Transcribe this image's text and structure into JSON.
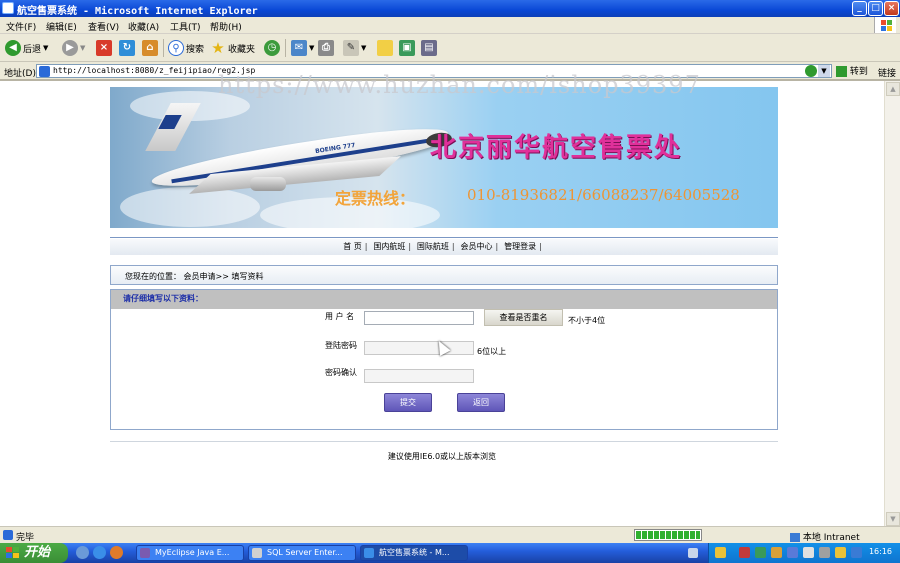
{
  "window": {
    "title": "航空售票系统 - Microsoft Internet Explorer",
    "minimize": "_",
    "maximize": "□",
    "close": "×"
  },
  "menu": [
    "文件(F)",
    "编辑(E)",
    "查看(V)",
    "收藏(A)",
    "工具(T)",
    "帮助(H)"
  ],
  "toolbar": {
    "back_label": "后退",
    "search_label": "搜索",
    "favorites_label": "收藏夹"
  },
  "address": {
    "label": "地址(D)",
    "url": "http://localhost:8080/z_feijipiao/reg2.jsp",
    "go_label": "转到",
    "links_label": "链接"
  },
  "watermark": "https://www.huzhan.com/ishop39397",
  "banner": {
    "brand": "BOEING 777",
    "title": "北京丽华航空售票处",
    "hotline_label": "定票热线：",
    "hotline_number": "010-81936821/66088237/64005528"
  },
  "nav": {
    "items": [
      "首 页",
      "国内航班",
      "国际航班",
      "会员中心",
      "管理登录"
    ],
    "separator": "|"
  },
  "breadcrumb": "您现在的位置： 会员申请>> 填写资料",
  "form": {
    "header": "请仔细填写以下资料：",
    "username_label": "用 户 名",
    "username_value": "",
    "check_button": "查看是否重名",
    "username_hint": "不小于4位",
    "password_label": "登陆密码",
    "password_value": "",
    "password_hint": "6位以上",
    "confirm_label": "密码确认",
    "confirm_value": "",
    "submit_button": "提交",
    "back_button": "返回"
  },
  "footer": "建议使用IE6.0或以上版本浏览",
  "status": {
    "text": "完毕",
    "progress_fraction": 1.0,
    "zone": "本地 Intranet"
  },
  "taskbar": {
    "start_label": "开始",
    "tasks": [
      "MyEclipse Java E...",
      "SQL Server Enter...",
      "航空售票系统 - M..."
    ],
    "clock": "16:16"
  },
  "colors": {
    "title_bar": "#0a48d6",
    "banner_title": "#e0309a",
    "hotline": "#f2a43a",
    "form_header_text": "#1c2ea8",
    "action_button": "#6b63c4",
    "start_button": "#3a8e36"
  }
}
